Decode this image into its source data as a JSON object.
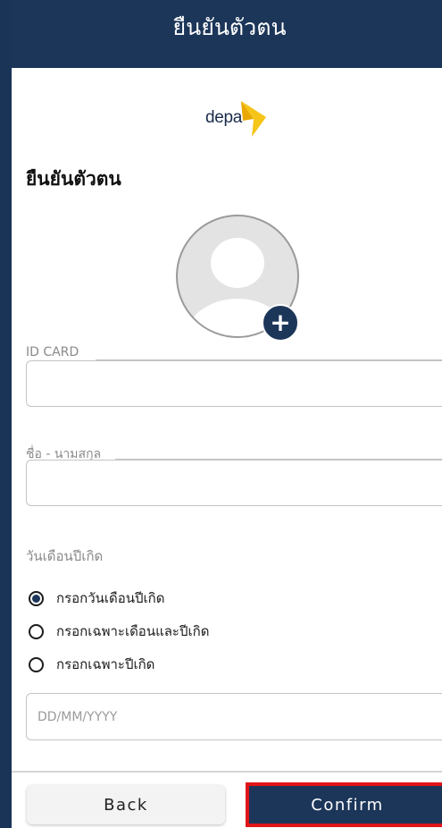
{
  "header": {
    "title": "ยืนยันตัวตน"
  },
  "logo": {
    "text": "depa"
  },
  "section": {
    "title": "ยืนยันตัวตน"
  },
  "form": {
    "id_card": {
      "label": "ID CARD",
      "value": "",
      "placeholder": ""
    },
    "full_name": {
      "label": "ชื่อ - นามสกุล",
      "value": "",
      "placeholder": ""
    },
    "birthdate": {
      "label": "วันเดือนปีเกิด",
      "options": [
        {
          "label": "กรอกวันเดือนปีเกิด",
          "selected": true
        },
        {
          "label": "กรอกเฉพาะเดือนและปีเกิด",
          "selected": false
        },
        {
          "label": "กรอกเฉพาะปีเกิด",
          "selected": false
        }
      ],
      "input_placeholder": "DD/MM/YYYY",
      "value": ""
    }
  },
  "footer": {
    "back_label": "Back",
    "confirm_label": "Confirm"
  },
  "colors": {
    "navy": "#1c3659",
    "logo_accent": "#f5c518",
    "highlight": "#e0141a"
  }
}
